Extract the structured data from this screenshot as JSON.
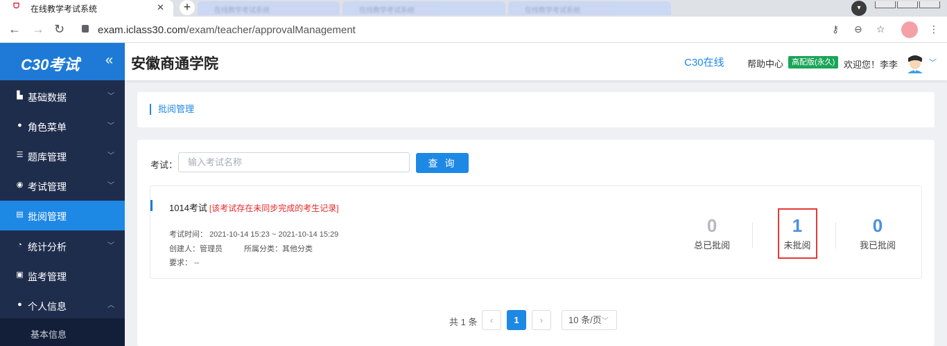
{
  "browser": {
    "active_tab_title": "在线教学考试系统",
    "background_tabs": [
      "在线教学考试系统",
      "在线教学考试系统",
      "在线教学考试系统"
    ],
    "url_host": "exam.iclass30.com",
    "url_path": "/exam/teacher/approvalManagement"
  },
  "sidebar": {
    "logo": "C30考试",
    "items": [
      {
        "label": "基础数据",
        "icon": "bar-chart-icon"
      },
      {
        "label": "角色菜单",
        "icon": "user-icon"
      },
      {
        "label": "题库管理",
        "icon": "list-icon"
      },
      {
        "label": "考试管理",
        "icon": "location-pin-icon"
      },
      {
        "label": "批阅管理",
        "icon": "document-icon"
      },
      {
        "label": "统计分析",
        "icon": "pie-chart-icon"
      },
      {
        "label": "监考管理",
        "icon": "monitor-icon"
      },
      {
        "label": "个人信息",
        "icon": "person-icon"
      }
    ],
    "submenu_item": "基本信息"
  },
  "header": {
    "org_name": "安徽商通学院",
    "c30_link": "C30在线",
    "help": "帮助中心",
    "edition_badge": "高配版(永久)",
    "welcome": "欢迎您！李李"
  },
  "breadcrumb": "批阅管理",
  "search": {
    "label": "考试：",
    "placeholder": "输入考试名称",
    "button": "查 询"
  },
  "exam": {
    "name": "1014考试",
    "warning": "[该考试存在未同步完成的考生记录]",
    "time_label": "考试时间：",
    "time_value": "2021-10-14 15:23 ~ 2021-10-14 15:29",
    "creator_label": "创建人：",
    "creator_value": "管理员",
    "category_label": "所属分类：",
    "category_value": "其他分类",
    "requirement_label": "要求：",
    "requirement_value": "--",
    "stats": [
      {
        "value": "0",
        "label": "总已批阅",
        "color": "#b5b9bf"
      },
      {
        "value": "1",
        "label": "未批阅",
        "color": "#4a90e2"
      },
      {
        "value": "0",
        "label": "我已批阅",
        "color": "#4a90e2"
      }
    ]
  },
  "pagination": {
    "total": "共 1 条",
    "prev": "‹",
    "current": "1",
    "next": "›",
    "page_size": "10 条/页"
  }
}
